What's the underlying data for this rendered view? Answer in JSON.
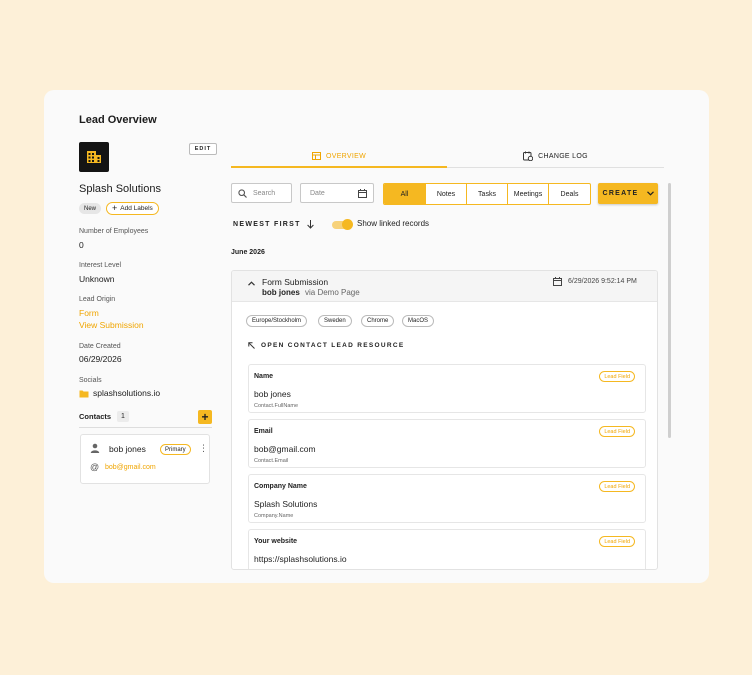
{
  "sidebar": {
    "title": "Lead Overview",
    "edit_label": "EDIT",
    "company_name": "Splash Solutions",
    "status_badge": "New",
    "add_labels": "Add Labels",
    "fields": {
      "employees_label": "Number of Employees",
      "employees_value": "0",
      "interest_label": "Interest Level",
      "interest_value": "Unknown",
      "origin_label": "Lead Origin",
      "origin_value": "Form",
      "view_submission": "View Submission",
      "date_label": "Date Created",
      "date_value": "06/29/2026",
      "socials_label": "Socials",
      "socials_value": "splashsolutions.io"
    },
    "contacts": {
      "title": "Contacts",
      "count": "1",
      "add": "+",
      "items": [
        {
          "name": "bob jones",
          "badge": "Primary",
          "email": "bob@gmail.com"
        }
      ]
    }
  },
  "tabs": [
    {
      "label": "OVERVIEW",
      "icon": "overview-icon",
      "active": true
    },
    {
      "label": "CHANGE LOG",
      "icon": "change-log-icon",
      "active": false
    }
  ],
  "toolbar": {
    "search_placeholder": "Search",
    "date_placeholder": "Date",
    "filters": [
      "All",
      "Notes",
      "Tasks",
      "Meetings",
      "Deals"
    ],
    "active_filter": "All",
    "create_label": "CREATE"
  },
  "sort": {
    "label": "NEWEST FIRST",
    "toggle_label": "Show linked records",
    "toggle_on": true
  },
  "timeline": {
    "month": "June 2026",
    "entry": {
      "title": "Form Submission",
      "author": "bob jones",
      "via": "via Demo Page",
      "timestamp": "6/29/2026 9:52:14 PM",
      "chips": [
        "Europe/Stockholm",
        "Sweden",
        "Chrome",
        "MacOS"
      ],
      "open_link": "OPEN CONTACT LEAD RESOURCE",
      "fields": [
        {
          "name": "Name",
          "value": "bob jones",
          "key": "Contact.FullName",
          "tag": "Lead Field"
        },
        {
          "name": "Email",
          "value": "bob@gmail.com",
          "key": "Contact.Email",
          "tag": "Lead Field"
        },
        {
          "name": "Company Name",
          "value": "Splash Solutions",
          "key": "Company.Name",
          "tag": "Lead Field"
        },
        {
          "name": "Your website",
          "value": "https://splashsolutions.io",
          "key": "",
          "tag": "Lead Field"
        }
      ]
    }
  },
  "colors": {
    "accent": "#f5b821",
    "accent_text": "#f0a500",
    "background": "#fdf0d8",
    "card": "#fafafa"
  }
}
